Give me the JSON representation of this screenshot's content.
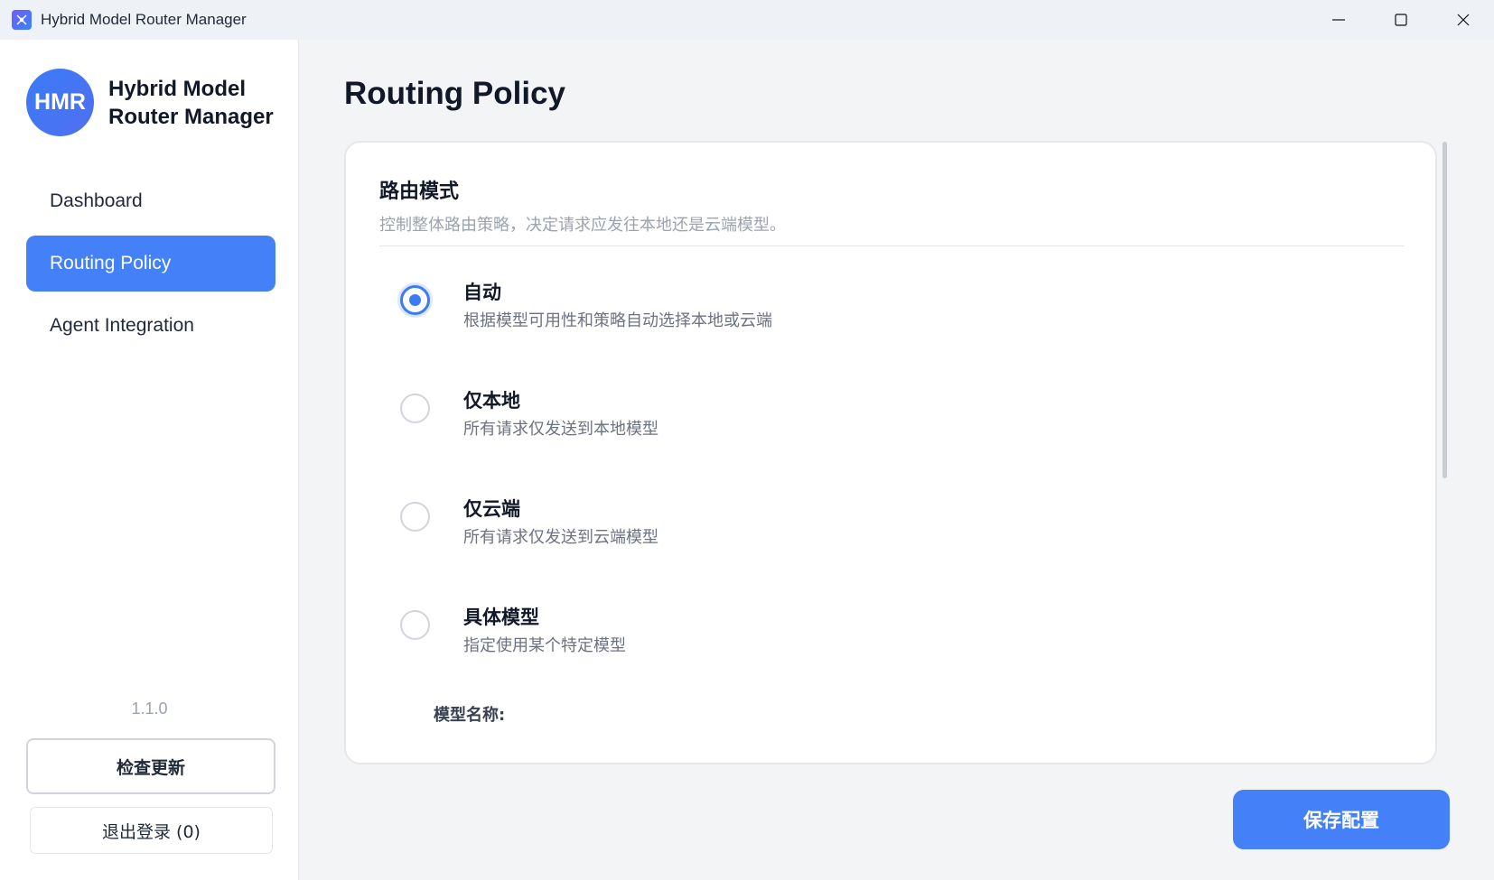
{
  "window": {
    "title": "Hybrid Model Router Manager",
    "icon": "router-app-icon",
    "controls": {
      "minimize": "minimize-icon",
      "maximize": "maximize-icon",
      "close": "close-icon"
    }
  },
  "sidebar": {
    "logo_text": "HMR",
    "brand_name_line1": "Hybrid Model",
    "brand_name_line2": "Router Manager",
    "nav": [
      {
        "label": "Dashboard",
        "active": false
      },
      {
        "label": "Routing Policy",
        "active": true
      },
      {
        "label": "Agent Integration",
        "active": false
      }
    ],
    "version": "1.1.0",
    "check_update_label": "检查更新",
    "logout_label": "退出登录 (0)"
  },
  "main": {
    "page_title": "Routing Policy",
    "section": {
      "title": "路由模式",
      "description": "控制整体路由策略，决定请求应发往本地还是云端模型。",
      "options": [
        {
          "label": "自动",
          "description": "根据模型可用性和策略自动选择本地或云端",
          "selected": true
        },
        {
          "label": "仅本地",
          "description": "所有请求仅发送到本地模型",
          "selected": false
        },
        {
          "label": "仅云端",
          "description": "所有请求仅发送到云端模型",
          "selected": false
        },
        {
          "label": "具体模型",
          "description": "指定使用某个特定模型",
          "selected": false
        }
      ],
      "model_name_label": "模型名称:"
    },
    "save_label": "保存配置"
  },
  "colors": {
    "accent": "#4480f7",
    "sidebar_bg": "#ffffff",
    "main_bg": "#f3f4f6"
  }
}
